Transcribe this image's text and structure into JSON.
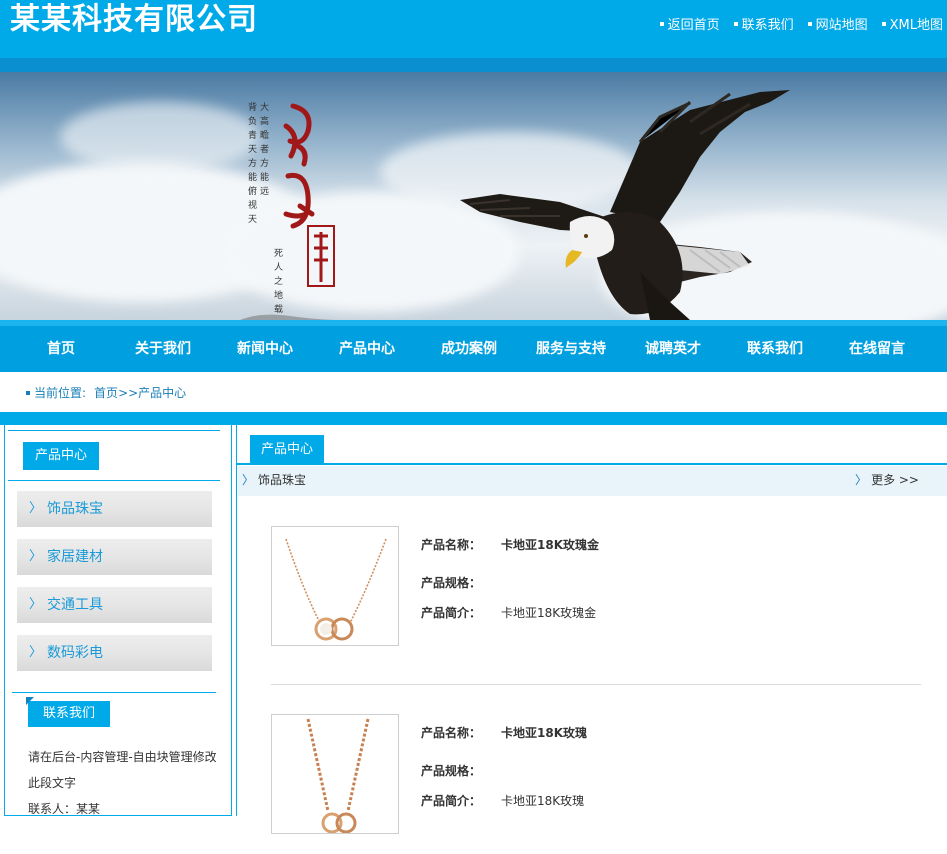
{
  "header": {
    "logo": "某某科技有限公司",
    "links": [
      "返回首页",
      "联系我们",
      "网站地图",
      "XML地图"
    ]
  },
  "nav": [
    "首页",
    "关于我们",
    "新闻中心",
    "产品中心",
    "成功案例",
    "服务与支持",
    "诚聘英才",
    "联系我们",
    "在线留言"
  ],
  "breadcrumb": {
    "label": "当前位置:",
    "home": "首页",
    "sep": ">>",
    "current": "产品中心"
  },
  "sidebar": {
    "title": "产品中心",
    "categories": [
      "饰品珠宝",
      "家居建材",
      "交通工具",
      "数码彩电"
    ],
    "contact_title": "联系我们",
    "contact_lines": [
      "请在后台-内容管理-自由块管理修改",
      "此段文字",
      "联系人：某某"
    ]
  },
  "main": {
    "tab": "产品中心",
    "section": "饰品珠宝",
    "more": "更多 >>",
    "products": [
      {
        "name_label": "产品名称：",
        "name": "卡地亚18K玫瑰金",
        "spec_label": "产品规格：",
        "spec": "",
        "desc_label": "产品简介：",
        "desc": "卡地亚18K玫瑰金"
      },
      {
        "name_label": "产品名称：",
        "name": "卡地亚18K玫瑰",
        "spec_label": "产品规格：",
        "spec": "",
        "desc_label": "产品简介：",
        "desc": "卡地亚18K玫瑰"
      }
    ]
  },
  "banner": {
    "calligraphy": "高瞻远瞩"
  }
}
